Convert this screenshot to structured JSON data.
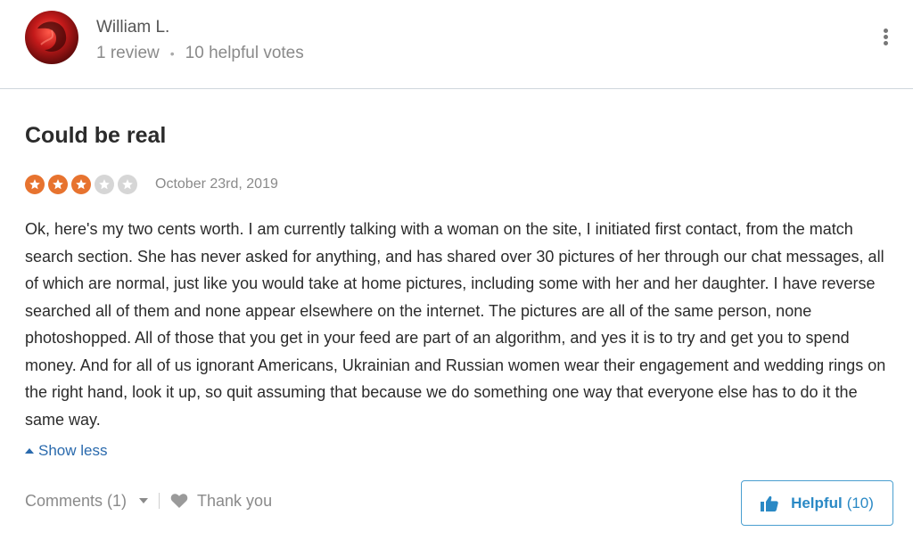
{
  "reviewer": {
    "name": "William L.",
    "review_count": "1 review",
    "separator": "•",
    "helpful_votes": "10 helpful votes"
  },
  "review": {
    "title": "Could be real",
    "rating": 3,
    "rating_max": 5,
    "date": "October 23rd, 2019",
    "text": "Ok, here's my two cents worth. I am currently talking with a woman on the site, I initiated first contact, from the match search section. She has never asked for anything, and has shared over 30 pictures of her through our chat messages, all of which are normal, just like you would take at home pictures, including some with her and her daughter. I have reverse searched all of them and none appear elsewhere on the internet. The pictures are all of the same person, none photoshopped. All of those that you get in your feed are part of an algorithm, and yes it is to try and get you to spend money. And for all of us ignorant Americans, Ukrainian and Russian women wear their engagement and wedding rings on the right hand, look it up, so quit assuming that because we do something one way that everyone else has to do it the same way.",
    "show_less_label": "Show less"
  },
  "footer": {
    "comments_label": "Comments (1)",
    "thank_label": "Thank you",
    "helpful_label": "Helpful",
    "helpful_count": "(10)"
  },
  "colors": {
    "star_on": "#e7732f",
    "star_off": "#d6d6d6",
    "link": "#2a6aad",
    "helpful": "#2a89c5"
  },
  "icons": {
    "menu": "kebab-menu-icon",
    "star": "star-icon",
    "thank": "heart-icon",
    "helpful": "thumbs-up-icon"
  }
}
